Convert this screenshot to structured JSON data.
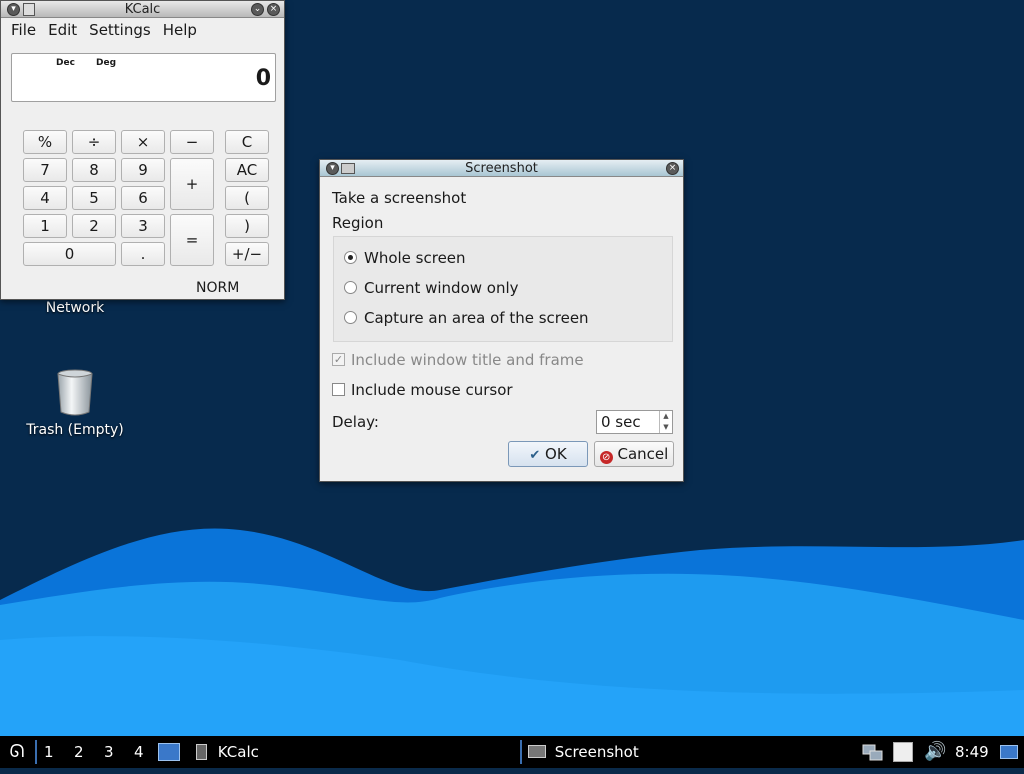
{
  "desktop": {
    "icons": [
      {
        "label": "Network",
        "icon": "network-icon"
      },
      {
        "label": "Trash (Empty)",
        "icon": "trash-icon"
      }
    ],
    "colors": {
      "background": "#072a4d",
      "wave_dark": "#0066cc",
      "wave_light": "#1aa3ff"
    }
  },
  "kcalc": {
    "title": "KCalc",
    "menu": [
      "File",
      "Edit",
      "Settings",
      "Help"
    ],
    "display": {
      "mode_base": "Dec",
      "mode_angle": "Deg",
      "value": "0"
    },
    "buttons": {
      "percent": "%",
      "divide": "÷",
      "multiply": "×",
      "minus": "−",
      "clear": "C",
      "seven": "7",
      "eight": "8",
      "nine": "9",
      "plus": "+",
      "all_clear": "AC",
      "four": "4",
      "five": "5",
      "six": "6",
      "open_paren": "(",
      "one": "1",
      "two": "2",
      "three": "3",
      "equals": "=",
      "close_paren": ")",
      "zero": "0",
      "decimal": ".",
      "plus_minus": "+/−"
    },
    "status": "NORM"
  },
  "screenshot": {
    "title": "Screenshot",
    "heading": "Take a screenshot",
    "region_label": "Region",
    "options": [
      {
        "label": "Whole screen",
        "checked": true
      },
      {
        "label": "Current window only",
        "checked": false
      },
      {
        "label": "Capture an area of the screen",
        "checked": false
      }
    ],
    "include_frame": {
      "label": "Include window title and frame",
      "checked": true,
      "enabled": false
    },
    "include_cursor": {
      "label": "Include mouse cursor",
      "checked": false
    },
    "delay": {
      "label": "Delay:",
      "value": "0 sec"
    },
    "ok_label": "OK",
    "cancel_label": "Cancel"
  },
  "taskbar": {
    "workspaces": [
      "1",
      "2",
      "3",
      "4"
    ],
    "tasks": [
      {
        "label": "KCalc",
        "icon": "calculator-icon"
      },
      {
        "label": "Screenshot",
        "icon": "camera-icon"
      }
    ],
    "clock": "8:49"
  }
}
